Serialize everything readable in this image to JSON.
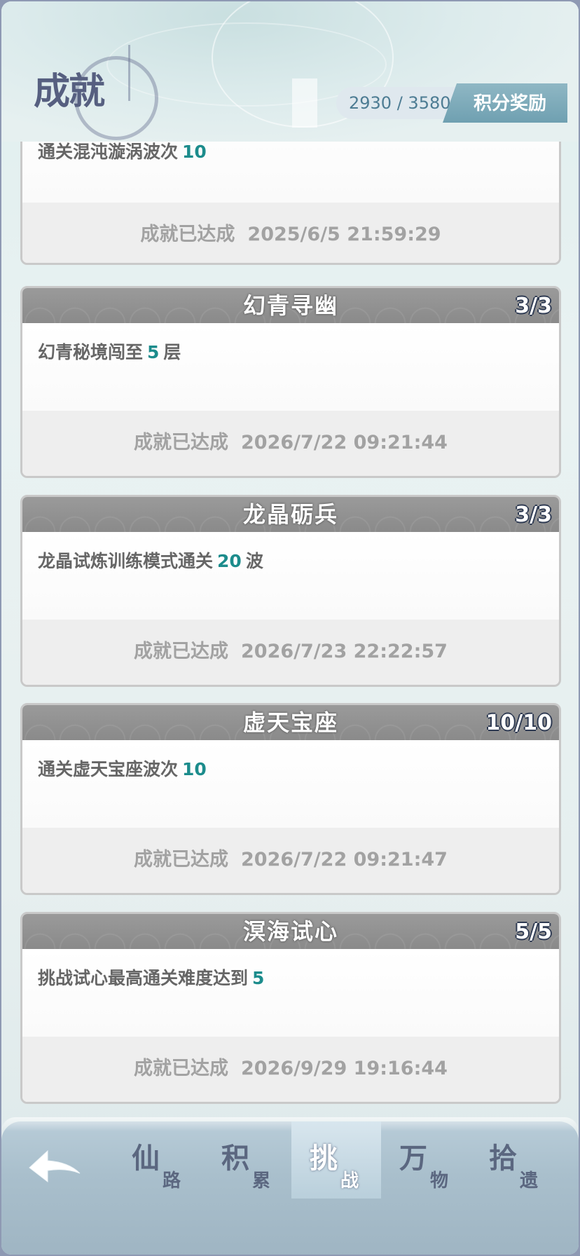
{
  "header": {
    "title": "成就",
    "score": "2930 / 3580",
    "reward_button": "积分奖励"
  },
  "cards": [
    {
      "title": "",
      "progress": "",
      "desc_prefix": "通关混沌漩涡波次",
      "desc_value": "10",
      "desc_suffix": "",
      "status": "成就已达成",
      "time": "2025/6/5 21:59:29"
    },
    {
      "title": "幻青寻幽",
      "progress": "3/3",
      "desc_prefix": "幻青秘境闯至",
      "desc_value": "5",
      "desc_suffix": "层",
      "status": "成就已达成",
      "time": "2026/7/22 09:21:44"
    },
    {
      "title": "龙晶砺兵",
      "progress": "3/3",
      "desc_prefix": "龙晶试炼训练模式通关",
      "desc_value": "20",
      "desc_suffix": "波",
      "status": "成就已达成",
      "time": "2026/7/23 22:22:57"
    },
    {
      "title": "虚天宝座",
      "progress": "10/10",
      "desc_prefix": "通关虚天宝座波次",
      "desc_value": "10",
      "desc_suffix": "",
      "status": "成就已达成",
      "time": "2026/7/22 09:21:47"
    },
    {
      "title": "溟海试心",
      "progress": "5/5",
      "desc_prefix": "挑战试心最高通关难度达到",
      "desc_value": "5",
      "desc_suffix": "",
      "status": "成就已达成",
      "time": "2026/9/29 19:16:44"
    }
  ],
  "nav": {
    "tabs": [
      {
        "big": "仙",
        "small": "路"
      },
      {
        "big": "积",
        "small": "累"
      },
      {
        "big": "挑",
        "small": "战"
      },
      {
        "big": "万",
        "small": "物"
      },
      {
        "big": "拾",
        "small": "遗"
      }
    ],
    "active_tab": "挑战"
  },
  "colors": {
    "value_accent": "#1c8c8c",
    "card_header": "#8f8f8f",
    "nav_bg": "#a9bfcc"
  },
  "icons": {
    "back": "back-arrow-icon"
  }
}
